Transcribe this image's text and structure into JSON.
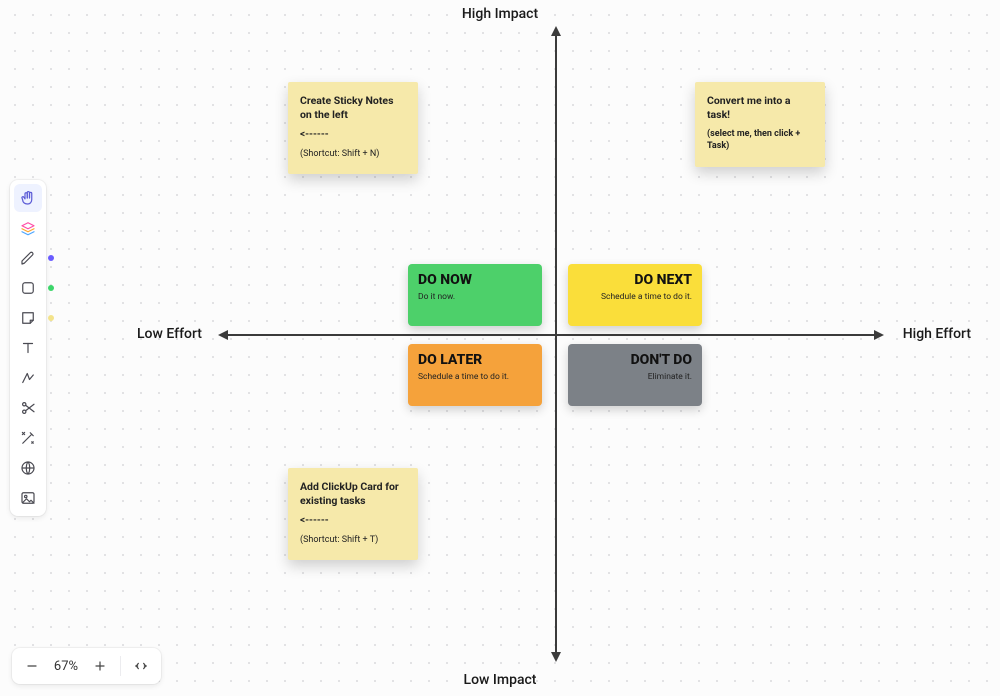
{
  "axes": {
    "top": "High Impact",
    "bottom": "Low Impact",
    "left": "Low Effort",
    "right": "High Effort"
  },
  "quadrants": {
    "do_now": {
      "title": "DO NOW",
      "sub": "Do it now."
    },
    "do_next": {
      "title": "DO NEXT",
      "sub": "Schedule a time to do it."
    },
    "do_later": {
      "title": "DO LATER",
      "sub": "Schedule a time to do it."
    },
    "dont_do": {
      "title": "DON'T DO",
      "sub": "Eliminate it."
    }
  },
  "stickies": {
    "create_notes": {
      "title": "Create Sticky Notes on the left",
      "arrow": "<------",
      "sub": "(Shortcut: Shift + N)"
    },
    "convert_task": {
      "title": "Convert me into a task!",
      "sub": "(select me, then click + Task)"
    },
    "add_card": {
      "title": "Add ClickUp Card for existing tasks",
      "arrow": "<------",
      "sub": "(Shortcut: Shift + T)"
    }
  },
  "zoom": {
    "level": "67%"
  },
  "colors": {
    "sticky": "#f6e9aa",
    "green": "#4dd06a",
    "yellow": "#fade3a",
    "orange": "#f5a23b",
    "gray": "#7c8187",
    "pen_dot": "#6a5cff",
    "shape_dot": "#3dd66a",
    "note_dot": "#f3e38b"
  },
  "toolbar_icons": [
    "hand-icon",
    "layers-icon",
    "pen-icon",
    "shape-icon",
    "sticky-note-icon",
    "text-icon",
    "connector-icon",
    "scissors-icon",
    "magic-icon",
    "web-icon",
    "image-icon"
  ]
}
